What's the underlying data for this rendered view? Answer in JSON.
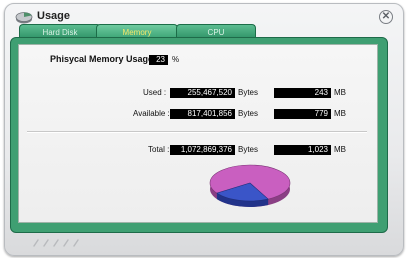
{
  "window": {
    "title": "Usage",
    "icon": "usage-icon",
    "close_icon": "close-icon"
  },
  "tabs": [
    {
      "label": "Hard Disk",
      "active": false
    },
    {
      "label": "Memory",
      "active": true
    },
    {
      "label": "CPU",
      "active": false
    }
  ],
  "physical": {
    "label": "Phisycal Memory Usage :",
    "value": "23",
    "unit": "%"
  },
  "rows": {
    "used": {
      "label": "Used :",
      "bytes": "255,467,520",
      "bytes_unit": "Bytes",
      "mb": "243",
      "mb_unit": "MB"
    },
    "available": {
      "label": "Available :",
      "bytes": "817,401,856",
      "bytes_unit": "Bytes",
      "mb": "779",
      "mb_unit": "MB"
    },
    "total": {
      "label": "Total :",
      "bytes": "1,072,869,376",
      "bytes_unit": "Bytes",
      "mb": "1,023",
      "mb_unit": "MB"
    }
  },
  "pie": {
    "used_fraction": 0.23,
    "colors": {
      "used": "#3a55c8",
      "available": "#c95fc0"
    }
  },
  "colors": {
    "accent": "#3f9f72",
    "tab_active_text": "#f5e86a"
  }
}
